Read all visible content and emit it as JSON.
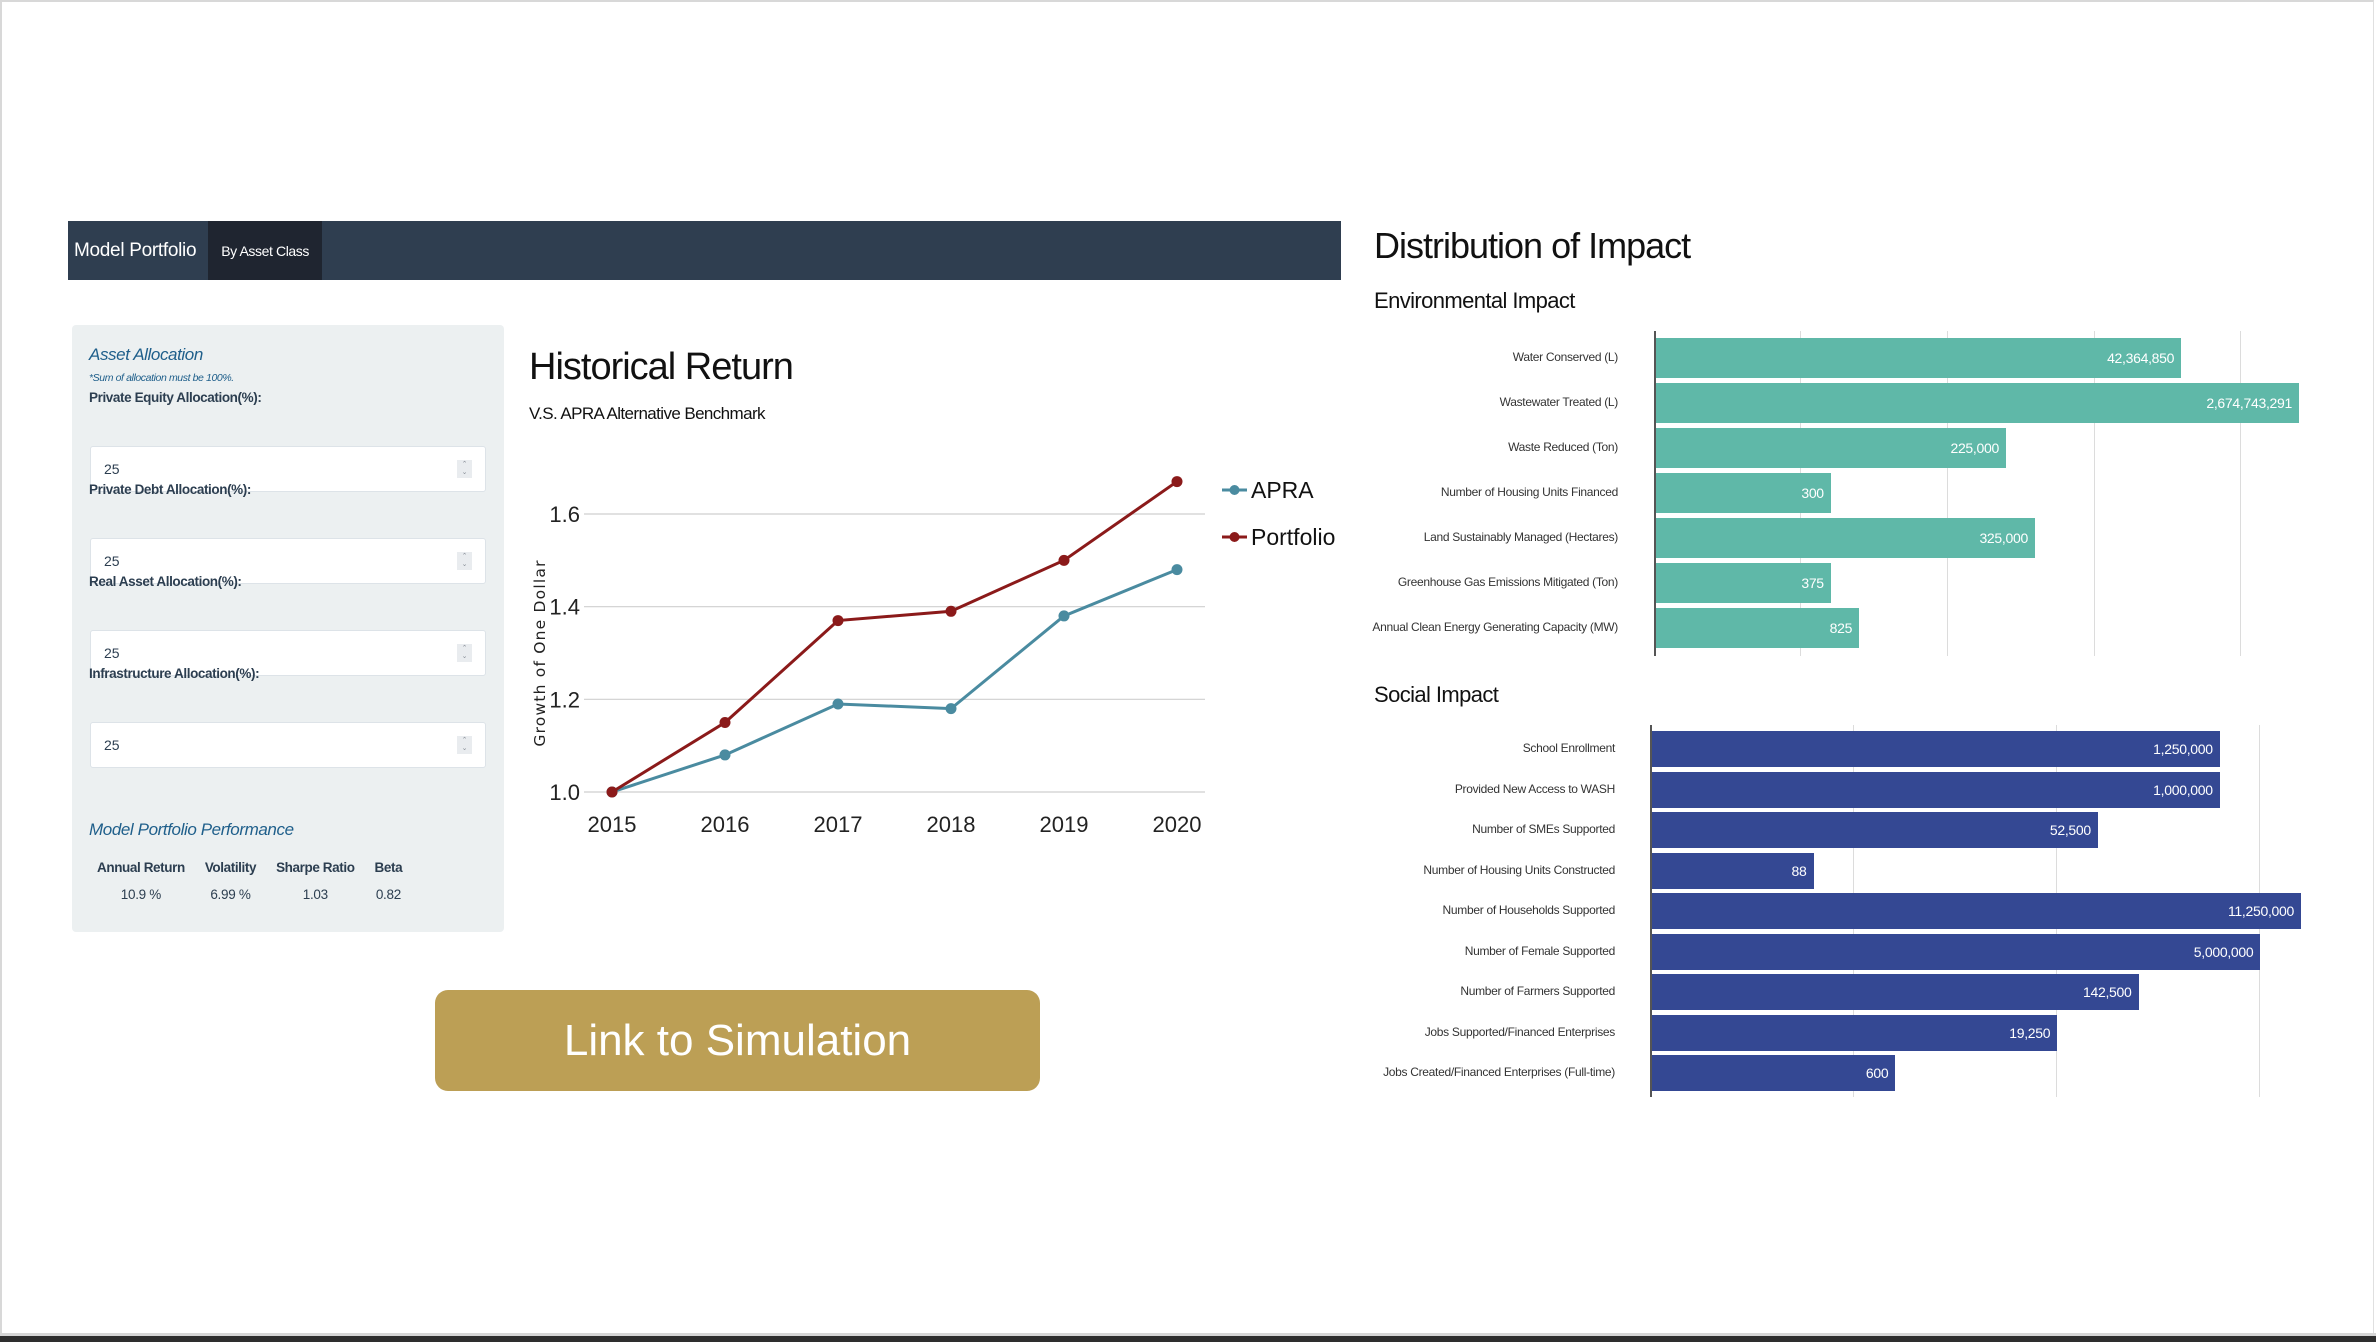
{
  "navbar": {
    "brand": "Model Portfolio",
    "tabs": [
      {
        "label": "By Asset Class",
        "active": true
      }
    ]
  },
  "sidebar": {
    "asset_allocation_title": "Asset Allocation",
    "note": "*Sum of allocation must be 100%.",
    "fields": [
      {
        "label": "Private Equity Allocation(%):",
        "value": "25"
      },
      {
        "label": "Private Debt Allocation(%):",
        "value": "25"
      },
      {
        "label": "Real Asset Allocation(%):",
        "value": "25"
      },
      {
        "label": "Infrastructure Allocation(%):",
        "value": "25"
      }
    ],
    "performance_title": "Model Portfolio Performance",
    "performance": {
      "headers": [
        "Annual Return",
        "Volatility",
        "Sharpe Ratio",
        "Beta"
      ],
      "values": [
        "10.9 %",
        "6.99 %",
        "1.03",
        "0.82"
      ]
    }
  },
  "historical": {
    "title": "Historical Return",
    "subtitle": "V.S. APRA Alternative Benchmark"
  },
  "simulation_button": "Link to Simulation",
  "impact": {
    "title": "Distribution of Impact",
    "environmental_title": "Environmental Impact",
    "social_title": "Social Impact"
  },
  "colors": {
    "navbar": "#2f3e50",
    "navbar_active_tab": "#1f2530",
    "panel_bg": "#ecf0f1",
    "accent_text": "#1f5f8b",
    "apra": "#4a8ba0",
    "portfolio": "#8b1a1a",
    "environmental_bar": "#5fb8a8",
    "social_bar": "#344893",
    "button": "#bc9f55"
  },
  "chart_data": [
    {
      "type": "line",
      "title": "Historical Return",
      "subtitle": "V.S. APRA Alternative Benchmark",
      "xlabel": "",
      "ylabel": "Growth of One Dollar",
      "x": [
        "2015",
        "2016",
        "2017",
        "2018",
        "2019",
        "2020"
      ],
      "yticks": [
        "1.0",
        "1.2",
        "1.4",
        "1.6"
      ],
      "ylim": [
        1.0,
        1.6
      ],
      "grid": true,
      "legend": "right",
      "series": [
        {
          "name": "APRA",
          "color": "#4a8ba0",
          "values": [
            1.0,
            1.08,
            1.19,
            1.18,
            1.38,
            1.48
          ]
        },
        {
          "name": "Portfolio",
          "color": "#8b1a1a",
          "values": [
            1.0,
            1.15,
            1.37,
            1.39,
            1.5,
            1.67
          ]
        }
      ]
    },
    {
      "type": "bar",
      "orientation": "horizontal",
      "title": "Environmental Impact",
      "scale": "non-linear (bar length shown as fraction of longest bar)",
      "grid": true,
      "categories": [
        "Water Conserved (L)",
        "Wastewater Treated (L)",
        "Waste Reduced (Ton)",
        "Number of Housing Units Financed",
        "Land Sustainably Managed (Hectares)",
        "Greenhouse Gas Emissions Mitigated (Ton)",
        "Annual Clean Energy Generating Capacity (MW)"
      ],
      "values": [
        42364850,
        2674743291,
        225000,
        300,
        325000,
        375,
        825
      ],
      "value_labels": [
        "42,364,850",
        "2,674,743,291",
        "225,000",
        "300",
        "325,000",
        "375",
        "825"
      ],
      "bar_fraction": [
        0.817,
        1.0,
        0.545,
        0.273,
        0.59,
        0.273,
        0.317
      ],
      "gridline_fractions": [
        0.227,
        0.455,
        0.683,
        0.91
      ]
    },
    {
      "type": "bar",
      "orientation": "horizontal",
      "title": "Social Impact",
      "scale": "non-linear (bar length shown as fraction of longest bar)",
      "grid": true,
      "categories": [
        "School Enrollment",
        "Provided New Access to WASH",
        "Number of SMEs Supported",
        "Number of Housing Units Constructed",
        "Number of Households Supported",
        "Number of Female Supported",
        "Number of Farmers Supported",
        "Jobs Supported/Financed Enterprises",
        "Jobs Created/Financed Enterprises (Full-time)"
      ],
      "values": [
        1250000,
        1000000,
        52500,
        88,
        11250000,
        5000000,
        142500,
        19250,
        600
      ],
      "value_labels": [
        "1,250,000",
        "1,000,000",
        "52,500",
        "88",
        "11,250,000",
        "5,000,000",
        "142,500",
        "19,250",
        "600"
      ],
      "bar_fraction": [
        0.875,
        0.875,
        0.6875,
        0.25,
        1.0,
        0.9375,
        0.75,
        0.625,
        0.376
      ],
      "gridline_fractions": [
        0.3125,
        0.625,
        0.9375
      ]
    }
  ]
}
